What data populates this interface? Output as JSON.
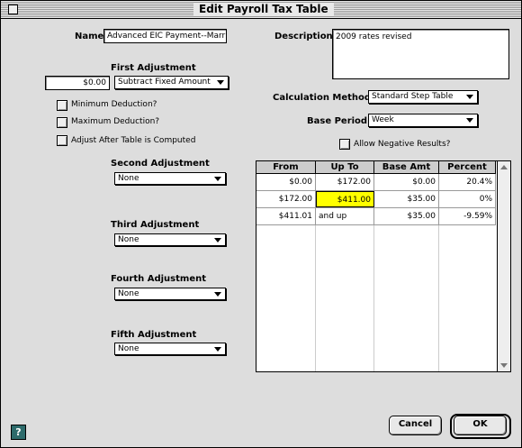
{
  "window": {
    "title": "Edit Payroll Tax Table"
  },
  "name": {
    "label": "Name",
    "value": "Advanced EIC Payment--Marr"
  },
  "description": {
    "label": "Description",
    "value": "2009 rates revised"
  },
  "first_adjustment": {
    "label": "First Adjustment",
    "amount": "$0.00",
    "type": "Subtract Fixed Amount",
    "min_deduction": "Minimum Deduction?",
    "max_deduction": "Maximum Deduction?",
    "adjust_after": "Adjust After Table is Computed"
  },
  "calculation_method": {
    "label": "Calculation Method",
    "value": "Standard Step Table"
  },
  "base_period": {
    "label": "Base Period",
    "value": "Week"
  },
  "allow_negative": {
    "label": "Allow Negative Results?"
  },
  "second_adjustment": {
    "label": "Second Adjustment",
    "value": "None"
  },
  "third_adjustment": {
    "label": "Third Adjustment",
    "value": "None"
  },
  "fourth_adjustment": {
    "label": "Fourth Adjustment",
    "value": "None"
  },
  "fifth_adjustment": {
    "label": "Fifth Adjustment",
    "value": "None"
  },
  "table": {
    "headers": [
      "From",
      "Up To",
      "Base Amt",
      "Percent"
    ],
    "rows": [
      [
        "$0.00",
        "$172.00",
        "$0.00",
        "20.4%"
      ],
      [
        "$172.00",
        "$411.00",
        "$35.00",
        "0%"
      ],
      [
        "$411.01",
        "and up",
        "$35.00",
        "-9.59%"
      ]
    ]
  },
  "buttons": {
    "cancel": "Cancel",
    "ok": "OK",
    "help": "?"
  }
}
